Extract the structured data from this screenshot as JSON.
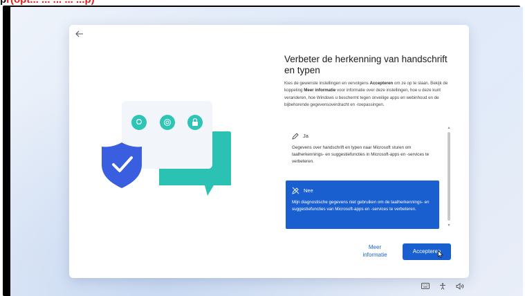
{
  "caption": {
    "prefix": "p",
    "red_text": "r(opt... ... ... ... ...p)"
  },
  "dialog": {
    "title": "Verbeter de herkenning van handschrift en typen",
    "description": {
      "p1": "Kies de gewenste instellingen en vervolgens ",
      "b1": "Accepteren",
      "p2": " om ze op te slaan. Bekijk de koppeling ",
      "b2": "Meer informatie",
      "p3": " voor informatie over deze instellingen, hoe u deze kunt veranderen, hoe Windows u beschermt tegen onveilige apps en webinhoud en de bijbehorende gegevensoverdracht en -toepassingen."
    },
    "options": [
      {
        "label": "Ja",
        "icon": "pen-icon",
        "text": "Gegevens over handschrift en typen naar Microsoft sturen om taalherkennings- en suggestiefuncties in Microsoft-apps en -services te verbeteren.",
        "selected": false
      },
      {
        "label": "Nee",
        "icon": "pen-off-icon",
        "text": "Mijn diagnostische gegevens niet gebruiken om de taalherkennings- en suggestiefuncties van Microsoft-apps en -services te verbeteren.",
        "selected": true
      }
    ],
    "meer_informatie": "Meer informatie",
    "accept_label": "Accepteren"
  },
  "colors": {
    "accent": "#1a5fd0",
    "shield": "#3a5ee0",
    "teal": "#2ec4b6",
    "caption_red": "#e0201c"
  },
  "tray_icons": [
    "keyboard-icon",
    "accessibility-icon",
    "volume-icon"
  ]
}
